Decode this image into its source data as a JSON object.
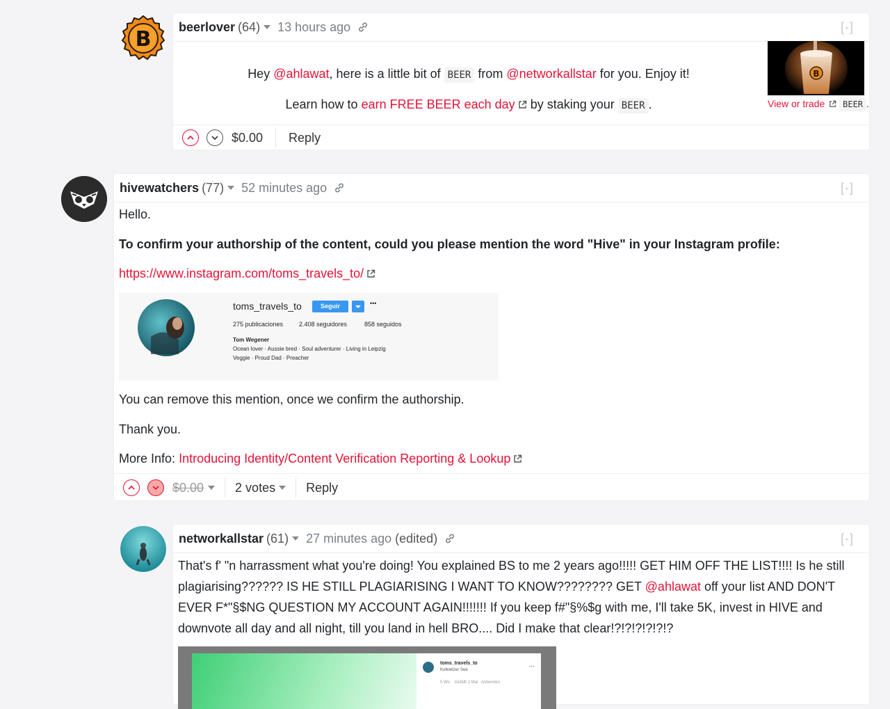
{
  "comments": [
    {
      "author": "beerlover",
      "reputation": "(64)",
      "time": "13 hours ago",
      "collapse": "[-]",
      "body": {
        "hey": "Hey",
        "mention1": "@ahlawat",
        "text1": ", here is a little bit of",
        "token": "BEER",
        "from": "from",
        "mention2": "@networkallstar",
        "text2": "for you. Enjoy it!",
        "learn": "Learn how to",
        "earn_link": "earn FREE BEER each day",
        "staking": "by staking your",
        "token2": "BEER",
        "dot": "."
      },
      "image_caption": {
        "link": "View or trade",
        "token": "BEER",
        "dot": "."
      },
      "payout": "$0.00",
      "reply": "Reply"
    },
    {
      "author": "hivewatchers",
      "reputation": "(77)",
      "time": "52 minutes ago",
      "collapse": "[-]",
      "paragraphs": {
        "hello": "Hello.",
        "confirm": "To confirm your authorship of the content, could you please mention the word \"Hive\" in your Instagram profile:",
        "link": "https://www.instagram.com/toms_travels_to/",
        "remove": "You can remove this mention, once we confirm the authorship.",
        "thanks": "Thank you.",
        "more_label": "More Info:",
        "more_link": "Introducing Identity/Content Verification Reporting & Lookup"
      },
      "instagram": {
        "username": "toms_travels_to",
        "follow_button": "Seguir",
        "more": "•••",
        "posts": "275 publicaciones",
        "followers": "2.408 seguidores",
        "following": "858 seguidos",
        "name": "Tom Wegener",
        "bio_line1": "Ocean lover · Aussie bred · Soul adventurer · Living in Leipzig",
        "bio_line2": "Veggie · Proud Dad · Preacher"
      },
      "payout": "$0.00",
      "votes": "2 votes",
      "reply": "Reply"
    },
    {
      "author": "networkallstar",
      "reputation": "(61)",
      "time": "27 minutes ago",
      "edited": "(edited)",
      "collapse": "[-]",
      "body_part1": "That's f' \"n harrassment what you're doing! You explained BS to me 2 years ago!!!!! GET HIM OFF THE LIST!!!! Is he still plagiarising?????? IS HE STILL PLAGIARISING I WANT TO KNOW???????? GET",
      "mention": "@ahlawat",
      "body_part2": "off your list AND DON'T EVER F*\"§$NG QUESTION MY ACCOUNT AGAIN!!!!!!! If you keep f#\"§%$g with me, I'll take 5K, invest in HIVE and downvote all day and all night, till you land in hell BRO.... Did I make that clear!?!?!?!?!?!?",
      "embedded": {
        "username": "toms_travels_to",
        "location": "Kulkwitzer See",
        "meta": "5 Wo.   Gefällt 1 Mal   Antworten",
        "more": "..."
      }
    }
  ],
  "colors": {
    "accent": "#e31337",
    "muted": "#788187",
    "border": "#eeeeee"
  },
  "icons": [
    "link-icon",
    "caret-down-icon",
    "upvote-icon",
    "downvote-icon",
    "external-link-icon"
  ]
}
